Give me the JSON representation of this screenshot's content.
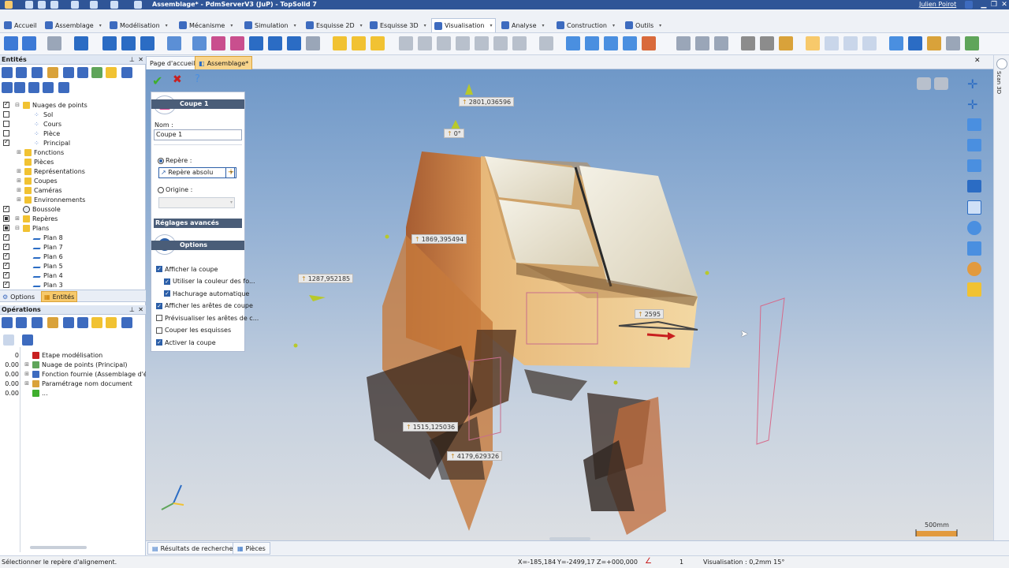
{
  "window": {
    "title": "Assemblage* - PdmServerV3 (JuP) - TopSolid 7",
    "user": "Julien Poirot"
  },
  "ribbon": {
    "tabs": [
      {
        "label": "Accueil"
      },
      {
        "label": "Assemblage"
      },
      {
        "label": "Modélisation"
      },
      {
        "label": "Mécanisme"
      },
      {
        "label": "Simulation"
      },
      {
        "label": "Esquisse 2D"
      },
      {
        "label": "Esquisse 3D"
      },
      {
        "label": "Visualisation"
      },
      {
        "label": "Analyse"
      },
      {
        "label": "Construction"
      },
      {
        "label": "Outils"
      }
    ],
    "active_tab": "Visualisation"
  },
  "entities_panel": {
    "title": "Entités",
    "tree": [
      {
        "label": "Nuages de points",
        "check": "on",
        "expand": "⊟",
        "icon": "folder",
        "indent": 0
      },
      {
        "label": "Sol",
        "check": "off",
        "expand": "",
        "icon": "pc",
        "indent": 1
      },
      {
        "label": "Cours",
        "check": "off",
        "expand": "",
        "icon": "pc",
        "indent": 1
      },
      {
        "label": "Pièce",
        "check": "off",
        "expand": "",
        "icon": "pc",
        "indent": 1
      },
      {
        "label": "Principal",
        "check": "on",
        "expand": "",
        "icon": "pc",
        "indent": 1
      },
      {
        "label": "Fonctions",
        "check": "none",
        "expand": "⊞",
        "icon": "folder",
        "indent": 0
      },
      {
        "label": "Pièces",
        "check": "none",
        "expand": "",
        "icon": "folder",
        "indent": 0
      },
      {
        "label": "Représentations",
        "check": "none",
        "expand": "⊞",
        "icon": "folder",
        "indent": 0
      },
      {
        "label": "Coupes",
        "check": "none",
        "expand": "⊞",
        "icon": "folder",
        "indent": 0
      },
      {
        "label": "Caméras",
        "check": "none",
        "expand": "⊞",
        "icon": "folder",
        "indent": 0
      },
      {
        "label": "Environnements",
        "check": "none",
        "expand": "⊞",
        "icon": "folder",
        "indent": 0
      },
      {
        "label": "Boussole",
        "check": "on",
        "expand": "",
        "icon": "compass",
        "indent": 0
      },
      {
        "label": "Repères",
        "check": "part",
        "expand": "⊞",
        "icon": "folder",
        "indent": 0
      },
      {
        "label": "Plans",
        "check": "part",
        "expand": "⊟",
        "icon": "folder",
        "indent": 0
      },
      {
        "label": "Plan 8",
        "check": "on",
        "expand": "",
        "icon": "plane",
        "indent": 1
      },
      {
        "label": "Plan 7",
        "check": "on",
        "expand": "",
        "icon": "plane",
        "indent": 1
      },
      {
        "label": "Plan 6",
        "check": "on",
        "expand": "",
        "icon": "plane",
        "indent": 1
      },
      {
        "label": "Plan 5",
        "check": "on",
        "expand": "",
        "icon": "plane",
        "indent": 1
      },
      {
        "label": "Plan 4",
        "check": "on",
        "expand": "",
        "icon": "plane",
        "indent": 1
      },
      {
        "label": "Plan 3",
        "check": "on",
        "expand": "",
        "icon": "plane",
        "indent": 1
      }
    ],
    "tabs": {
      "options": "Options",
      "entities": "Entités"
    }
  },
  "operations_panel": {
    "title": "Opérations",
    "rows": [
      {
        "num": "0",
        "label": "Etape modélisation",
        "expand": ""
      },
      {
        "num": "0.00",
        "label": "Nuage de points (Principal)",
        "expand": "⊞"
      },
      {
        "num": "0.00",
        "label": "Fonction fournie (Assemblage d'élér",
        "expand": "⊞"
      },
      {
        "num": "0.00",
        "label": "Paramétrage nom document",
        "expand": "⊞"
      },
      {
        "num": "0.00",
        "label": "...",
        "expand": ""
      }
    ]
  },
  "doc_tabs": [
    {
      "label": "Page d'accueil"
    },
    {
      "label": "Assemblage*"
    }
  ],
  "coupe_panel": {
    "title": "Coupe 1",
    "name_label": "Nom :",
    "name_value": "Coupe 1",
    "repere_label": "Repère :",
    "repere_value": "Repère absolu",
    "origine_label": "Origine :",
    "advanced_label": "Réglages avancés",
    "options_title": "Options",
    "options": [
      {
        "label": "Afficher la coupe",
        "checked": true,
        "indent": 0
      },
      {
        "label": "Utiliser la couleur des fo...",
        "checked": true,
        "indent": 1
      },
      {
        "label": "Hachurage automatique",
        "checked": true,
        "indent": 1
      },
      {
        "label": "Afficher les arêtes de coupe",
        "checked": true,
        "indent": 0
      },
      {
        "label": "Prévisualiser les arêtes de c...",
        "checked": false,
        "indent": 0
      },
      {
        "label": "Couper les esquisses",
        "checked": false,
        "indent": 0
      },
      {
        "label": "Activer la coupe",
        "checked": true,
        "indent": 0
      }
    ]
  },
  "viewport": {
    "annotations": [
      {
        "label": "2801,036596"
      },
      {
        "label": "0°"
      },
      {
        "label": "1869,395494"
      },
      {
        "label": "1287,952185"
      },
      {
        "label": "2595"
      },
      {
        "label": "1515,125036"
      },
      {
        "label": "4179,629326"
      }
    ],
    "scale_label": "500mm",
    "right_strip_label": "Scan 3D"
  },
  "bottom_tabs": [
    {
      "label": "Résultats de recherche"
    },
    {
      "label": "Pièces"
    }
  ],
  "status": {
    "message": "Sélectionner le repère d'alignement.",
    "x": "X=-185,184",
    "y": "Y=-2499,17",
    "z": "Z=+000,000",
    "count": "1",
    "visualisation": "Visualisation : 0,2mm 15°"
  },
  "colors": {
    "title_bar": "#2f5597",
    "accent_orange": "#f7c96b",
    "panel_header": "#4a5d78"
  }
}
